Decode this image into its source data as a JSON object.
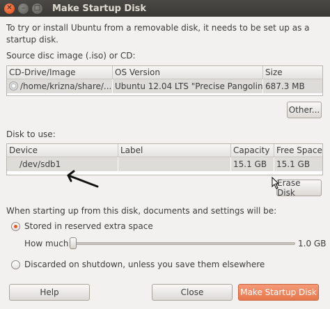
{
  "window": {
    "title": "Make Startup Disk"
  },
  "intro_text": "To try or install Ubuntu from a removable disk, it needs to be set up as a startup disk.",
  "source": {
    "label": "Source disc image (.iso) or CD:",
    "columns": [
      "CD-Drive/Image",
      "OS Version",
      "Size"
    ],
    "rows": [
      {
        "image": "/home/krizna/share/...",
        "os_version": "Ubuntu 12.04 LTS \"Precise Pangolin\"...",
        "size": "687.3 MB"
      }
    ],
    "other_button": "Other..."
  },
  "disk": {
    "label": "Disk to use:",
    "columns": [
      "Device",
      "Label",
      "Capacity",
      "Free Space"
    ],
    "rows": [
      {
        "device": "/dev/sdb1",
        "label": "",
        "capacity": "15.1 GB",
        "free": "15.1 GB"
      }
    ],
    "erase_button": "Erase Disk"
  },
  "startup": {
    "heading": "When starting up from this disk, documents and settings will be:",
    "option_reserved": "Stored in reserved extra space",
    "how_much_label": "How much:",
    "how_much_value": "1.0 GB",
    "slider_fraction": 0.0,
    "option_discard": "Discarded on shutdown, unless you save them elsewhere",
    "selected": "reserved"
  },
  "buttons": {
    "help": "Help",
    "close": "Close",
    "make": "Make Startup Disk"
  },
  "icons": {
    "close": "close-icon",
    "minimize": "minimize-icon",
    "maximize": "maximize-icon"
  },
  "colors": {
    "accent": "#e6592a",
    "titlebar": "#3c3b37"
  }
}
